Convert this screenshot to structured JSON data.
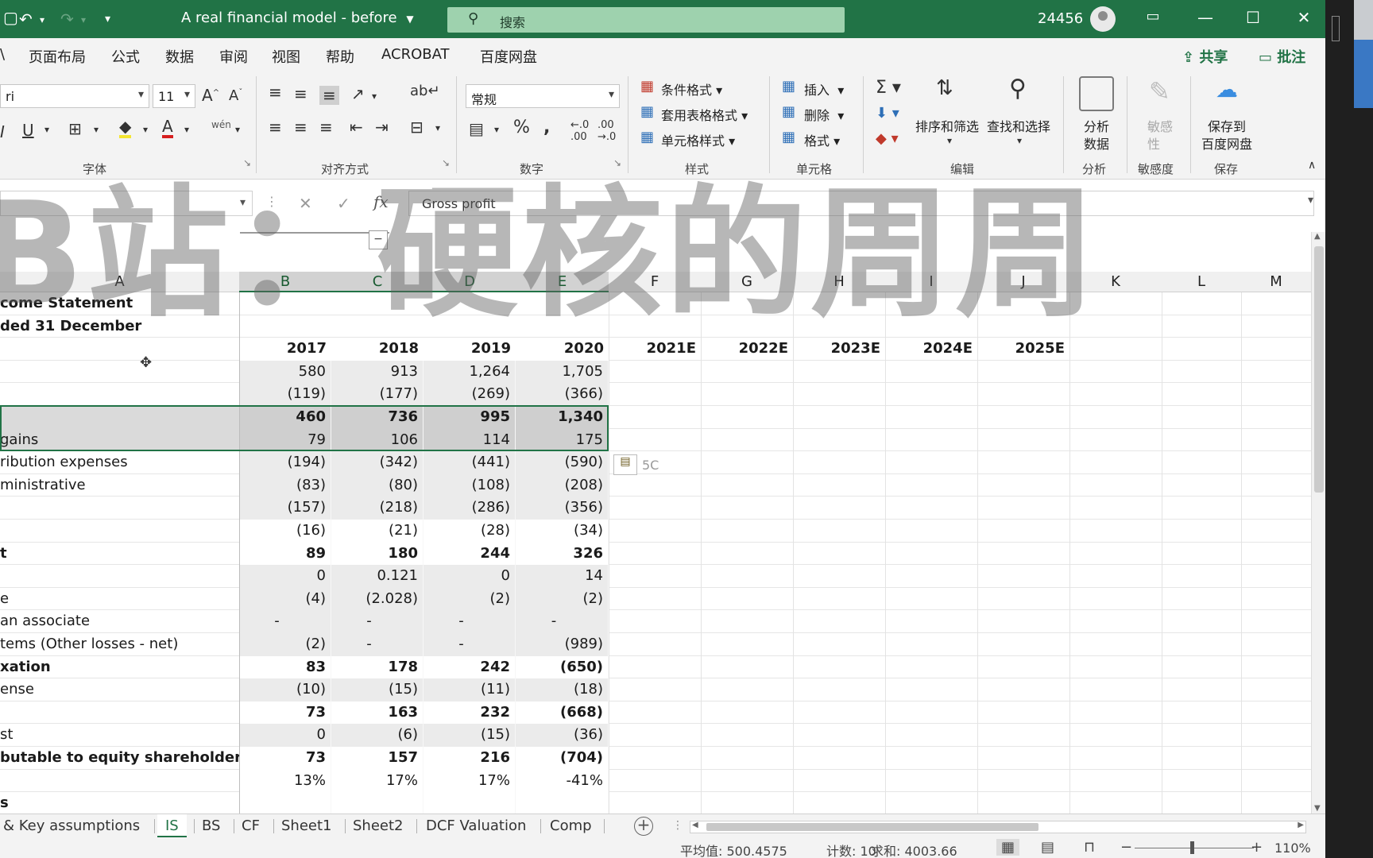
{
  "titlebar": {
    "doc_title": "A real financial model - before",
    "search_placeholder": "搜索",
    "user_id": "24456"
  },
  "menu": [
    "页面布局",
    "公式",
    "数据",
    "审阅",
    "视图",
    "帮助",
    "ACROBAT",
    "百度网盘"
  ],
  "menu_partial": "\\",
  "share": "共享",
  "comments": "批注",
  "ribbon": {
    "font_name": "ri",
    "font_size": "11",
    "number_format": "常规",
    "groups": {
      "font": "字体",
      "alignment": "对齐方式",
      "number": "数字",
      "styles": "样式",
      "cells": "单元格",
      "editing": "编辑",
      "analysis": "分析",
      "sensitivity": "敏感度",
      "save": "保存"
    },
    "styles": [
      "条件格式",
      "套用表格格式",
      "单元格样式"
    ],
    "cells": [
      "插入",
      "删除",
      "格式"
    ],
    "sort_filter": "排序和筛选",
    "find_select": "查找和选择",
    "analyze_data": [
      "分析",
      "数据"
    ],
    "sensitivity_btn": [
      "敏感",
      "性"
    ],
    "save_to_pan": [
      "保存到",
      "百度网盘"
    ],
    "wen": "wén"
  },
  "formula": {
    "content": "Gross profit"
  },
  "columns": [
    "A",
    "B",
    "C",
    "D",
    "E",
    "F",
    "G",
    "H",
    "I",
    "J",
    "K",
    "L",
    "M"
  ],
  "selected_columns": [
    "B",
    "C",
    "D",
    "E"
  ],
  "rows": [
    {
      "label": "come Statement",
      "bold": true,
      "vals": [
        "",
        "",
        "",
        ""
      ],
      "proj": []
    },
    {
      "label": "ded 31 December",
      "bold": true,
      "vals": [
        "",
        "",
        "",
        ""
      ],
      "proj": []
    },
    {
      "label": "",
      "bold": true,
      "header": true,
      "vals": [
        "2017",
        "2018",
        "2019",
        "2020"
      ],
      "proj": [
        "2021E",
        "2022E",
        "2023E",
        "2024E",
        "2025E"
      ]
    },
    {
      "label": "",
      "vals": [
        "580",
        "913",
        "1,264",
        "1,705"
      ]
    },
    {
      "label": "",
      "vals": [
        "(119)",
        "(177)",
        "(269)",
        "(366)"
      ]
    },
    {
      "label": "",
      "bold": true,
      "sel": true,
      "vals": [
        "460",
        "736",
        "995",
        "1,340"
      ]
    },
    {
      "label": " gains",
      "sel": true,
      "vals": [
        "79",
        "106",
        "114",
        "175"
      ]
    },
    {
      "label": "ribution expenses",
      "vals": [
        "(194)",
        "(342)",
        "(441)",
        "(590)"
      ]
    },
    {
      "label": "ministrative",
      "vals": [
        "(83)",
        "(80)",
        "(108)",
        "(208)"
      ]
    },
    {
      "label": "",
      "vals": [
        "(157)",
        "(218)",
        "(286)",
        "(356)"
      ]
    },
    {
      "label": "",
      "white": true,
      "vals": [
        "(16)",
        "(21)",
        "(28)",
        "(34)"
      ]
    },
    {
      "label": "t",
      "bold": true,
      "white": true,
      "vals": [
        "89",
        "180",
        "244",
        "326"
      ]
    },
    {
      "label": "",
      "vals": [
        "0",
        "0.121",
        "0",
        "14"
      ]
    },
    {
      "label": "e",
      "vals": [
        "(4)",
        "(2.028)",
        "(2)",
        "(2)"
      ]
    },
    {
      "label": "an associate",
      "vals": [
        "-",
        "-",
        "-",
        "-"
      ],
      "center": true
    },
    {
      "label": "tems (Other losses - net)",
      "vals": [
        "(2)",
        "-",
        "-",
        "(989)"
      ],
      "dashcenter": true
    },
    {
      "label": "xation",
      "bold": true,
      "white": true,
      "vals": [
        "83",
        "178",
        "242",
        "(650)"
      ]
    },
    {
      "label": "ense",
      "vals": [
        "(10)",
        "(15)",
        "(11)",
        "(18)"
      ]
    },
    {
      "label": "",
      "bold": true,
      "white": true,
      "vals": [
        "73",
        "163",
        "232",
        "(668)"
      ]
    },
    {
      "label": "st",
      "vals": [
        "0",
        "(6)",
        "(15)",
        "(36)"
      ]
    },
    {
      "label": "butable to equity shareholder",
      "bold": true,
      "white": true,
      "vals": [
        "73",
        "157",
        "216",
        "(704)"
      ]
    },
    {
      "label": "",
      "white": true,
      "vals": [
        "13%",
        "17%",
        "17%",
        "-41%"
      ]
    },
    {
      "label": "s",
      "bold": true,
      "white": true,
      "vals": [
        "",
        "",
        "",
        ""
      ]
    }
  ],
  "quick_analysis_label": "5C",
  "watermark": "B站：硬核的周周",
  "sheets": [
    "& Key assumptions",
    "IS",
    "BS",
    "CF",
    "Sheet1",
    "Sheet2",
    "DCF Valuation",
    "Comp"
  ],
  "active_sheet": "IS",
  "status": {
    "average": "平均值: 500.4575",
    "count": "计数: 10",
    "sum": "求和: 4003.66",
    "zoom": "110%"
  },
  "colors": {
    "accent": "#217346",
    "selection": "#217346",
    "data_fill": "#ebebeb"
  },
  "icons": [
    "undo-icon",
    "redo-icon",
    "search-icon",
    "avatar-icon",
    "minimize-icon",
    "maximize-icon",
    "close-icon",
    "fx-icon",
    "add-sheet-icon",
    "quick-analysis-icon"
  ]
}
